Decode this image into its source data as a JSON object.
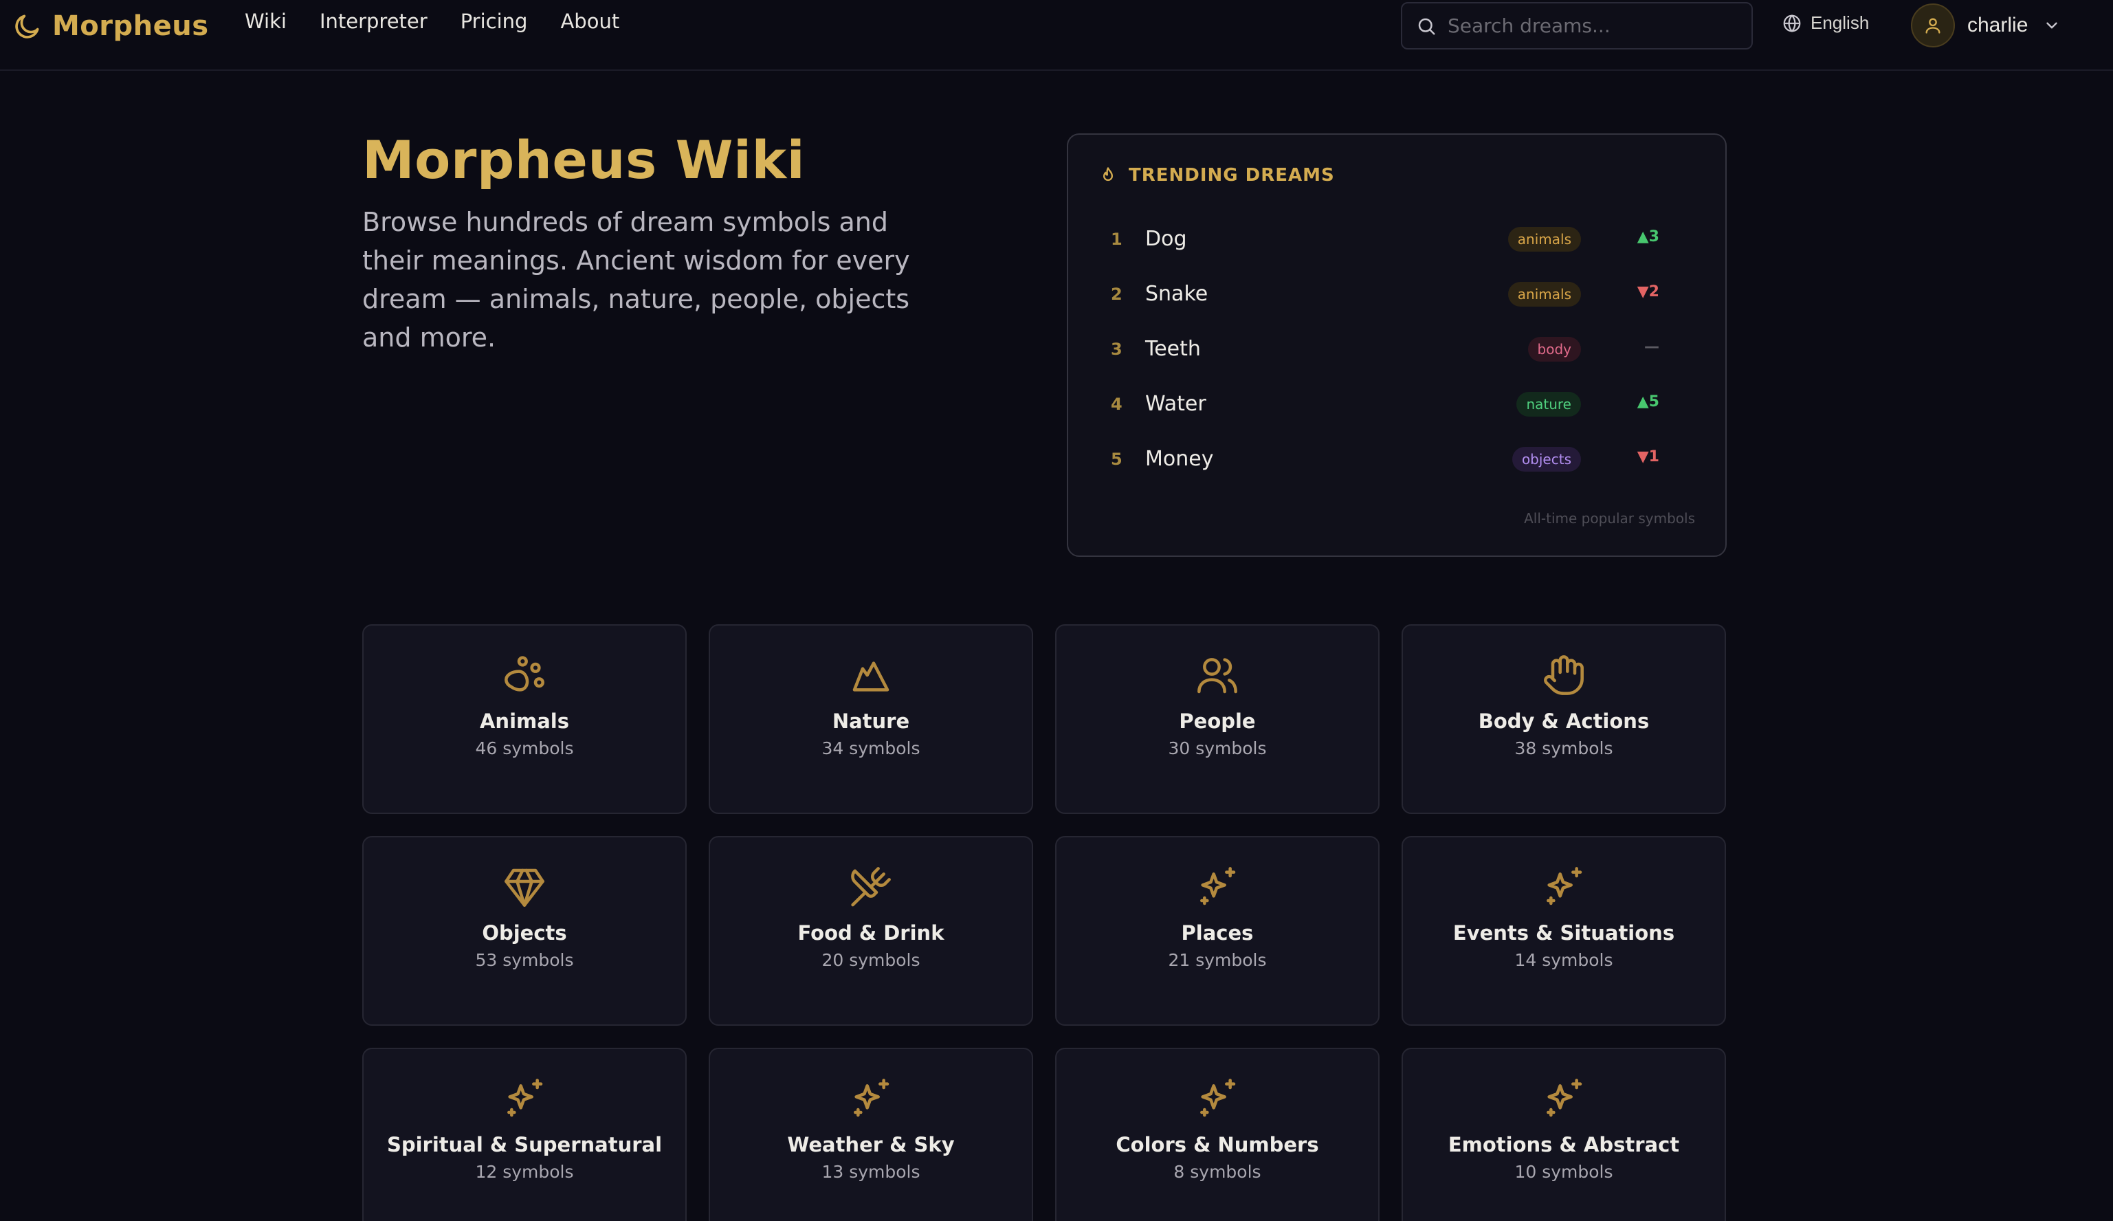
{
  "nav": {
    "brand": "Morpheus",
    "links": [
      "Wiki",
      "Interpreter",
      "Pricing",
      "About"
    ],
    "search_placeholder": "Search dreams...",
    "language": "English",
    "username": "charlie"
  },
  "hero": {
    "title": "Morpheus Wiki",
    "description": "Browse hundreds of dream symbols and their meanings. Ancient wisdom for every dream — animals, nature, people, objects and more."
  },
  "trending": {
    "title": "TRENDING DREAMS",
    "items": [
      {
        "rank": "1",
        "name": "Dog",
        "tag": "animals",
        "change": "▲3"
      },
      {
        "rank": "2",
        "name": "Snake",
        "tag": "animals",
        "change": "▼2"
      },
      {
        "rank": "3",
        "name": "Teeth",
        "tag": "body",
        "change": "—"
      },
      {
        "rank": "4",
        "name": "Water",
        "tag": "nature",
        "change": "▲5"
      },
      {
        "rank": "5",
        "name": "Money",
        "tag": "objects",
        "change": "▼1"
      }
    ],
    "footer": "All-time popular symbols"
  },
  "categories": [
    {
      "name": "Animals",
      "count": "46 symbols",
      "icon": "paw-icon"
    },
    {
      "name": "Nature",
      "count": "34 symbols",
      "icon": "mountain-icon"
    },
    {
      "name": "People",
      "count": "30 symbols",
      "icon": "people-icon"
    },
    {
      "name": "Body & Actions",
      "count": "38 symbols",
      "icon": "hand-icon"
    },
    {
      "name": "Objects",
      "count": "53 symbols",
      "icon": "gem-icon"
    },
    {
      "name": "Food & Drink",
      "count": "20 symbols",
      "icon": "utensils-icon"
    },
    {
      "name": "Places",
      "count": "21 symbols",
      "icon": "sparkles-icon"
    },
    {
      "name": "Events & Situations",
      "count": "14 symbols",
      "icon": "sparkles-icon"
    },
    {
      "name": "Spiritual & Supernatural",
      "count": "12 symbols",
      "icon": "sparkles-icon"
    },
    {
      "name": "Weather & Sky",
      "count": "13 symbols",
      "icon": "sparkles-icon"
    },
    {
      "name": "Colors & Numbers",
      "count": "8 symbols",
      "icon": "sparkles-icon"
    },
    {
      "name": "Emotions & Abstract",
      "count": "10 symbols",
      "icon": "sparkles-icon"
    }
  ],
  "colors": {
    "accent": "#d4ac50",
    "background": "#0b0b14",
    "card": "#13131f"
  }
}
